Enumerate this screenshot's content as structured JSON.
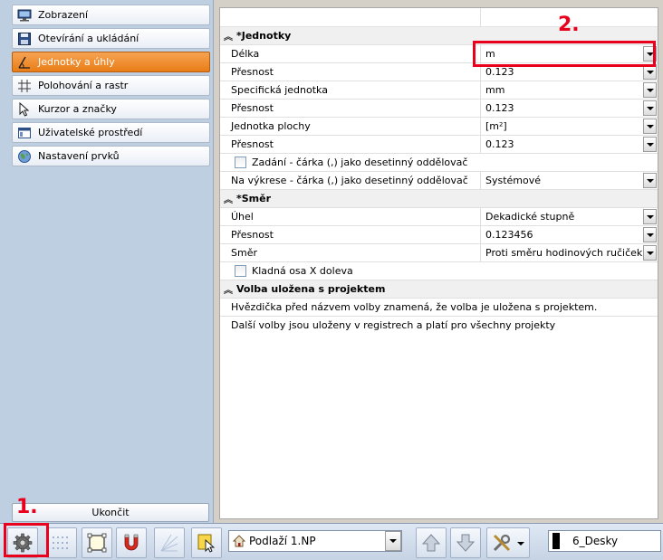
{
  "sidebar": {
    "items": [
      {
        "label": "Zobrazení",
        "icon": "monitor-icon"
      },
      {
        "label": "Otevírání a ukládání",
        "icon": "save-folder-icon"
      },
      {
        "label": "Jednotky a úhly",
        "icon": "angle-units-icon"
      },
      {
        "label": "Polohování a rastr",
        "icon": "grid-raster-icon"
      },
      {
        "label": "Kurzor a značky",
        "icon": "cursor-icon"
      },
      {
        "label": "Uživatelské prostředí",
        "icon": "window-layout-icon"
      },
      {
        "label": "Nastavení prvků",
        "icon": "globe-icon"
      }
    ],
    "active_index": 2,
    "close_label": "Ukončit"
  },
  "grid": {
    "units_section": "*Jednotky",
    "length_label": "Délka",
    "length_value": "m",
    "length_precision_label": "Přesnost",
    "length_precision_value": "0.123",
    "specific_unit_label": "Specifická jednotka",
    "specific_unit_value": "mm",
    "specific_precision_label": "Přesnost",
    "specific_precision_value": "0.123",
    "area_unit_label": "Jednotka plochy",
    "area_unit_value": "[m²]",
    "area_precision_label": "Přesnost",
    "area_precision_value": "0.123",
    "input_comma_label": "Zadání - čárka (,) jako desetinný oddělovač",
    "drawing_comma_label": "Na výkrese - čárka (,) jako desetinný oddělovač",
    "drawing_comma_value": "Systémové",
    "direction_section": "*Směr",
    "angle_label": "Úhel",
    "angle_value": "Dekadické stupně",
    "angle_precision_label": "Přesnost",
    "angle_precision_value": "0.123456",
    "direction_label": "Směr",
    "direction_value": "Proti směru hodinových ručiček",
    "positive_x_label": "Kladná osa X doleva",
    "saved_section": "Volba uložena s projektem",
    "info_line_1": "Hvězdička před názvem volby znamená, že volba je uložena s projektem.",
    "info_line_2": "Další volby jsou uloženy v registrech a platí pro všechny projekty"
  },
  "annotations": {
    "marker_1": "1.",
    "marker_2": "2."
  },
  "toolbar": {
    "floor_value": "Podlaží 1.NP",
    "layer_value": "6_Desky"
  },
  "colors": {
    "accent_orange": "#e97d16",
    "annotation_red": "#e8001c",
    "sidebar_background": "#bfcfe2"
  }
}
